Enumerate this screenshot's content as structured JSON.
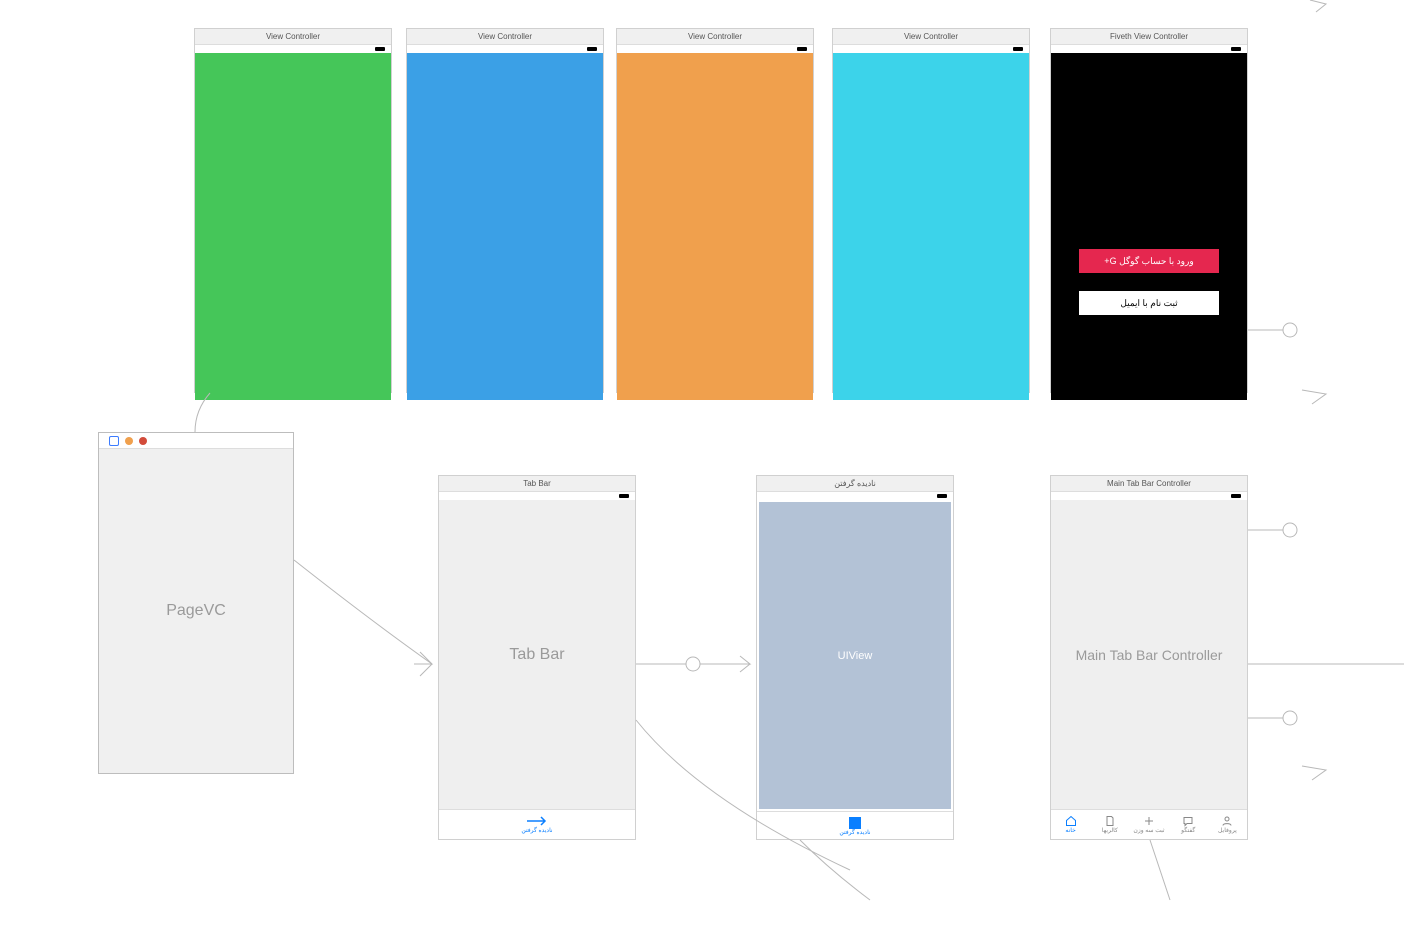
{
  "topScenes": [
    {
      "title": "View Controller",
      "color": "#45c659"
    },
    {
      "title": "View Controller",
      "color": "#3ba0e6"
    },
    {
      "title": "View Controller",
      "color": "#f0a04d"
    },
    {
      "title": "View Controller",
      "color": "#3cd3ea"
    }
  ],
  "fiveth": {
    "title": "Fiveth View Controller",
    "googleLabel": "ورود با حساب گوگل  G+",
    "emailLabel": "ثبت نام با ایمیل"
  },
  "pageVC": {
    "label": "PageVC"
  },
  "tabBar": {
    "title": "Tab Bar",
    "centerLabel": "Tab Bar",
    "bottomLabel": "نادیده گرفتن"
  },
  "unseen": {
    "title": "نادیده گرفتن",
    "centerLabel": "UIView",
    "bottomLabel": "نادیده گرفتن"
  },
  "mainTab": {
    "title": "Main Tab Bar Controller",
    "centerLabel": "Main Tab Bar Controller",
    "tabs": [
      {
        "label": "خانه",
        "active": true
      },
      {
        "label": "کالریها"
      },
      {
        "label": "ثبت سه وزن"
      },
      {
        "label": "گفتگو"
      },
      {
        "label": "پروفایل"
      }
    ]
  }
}
